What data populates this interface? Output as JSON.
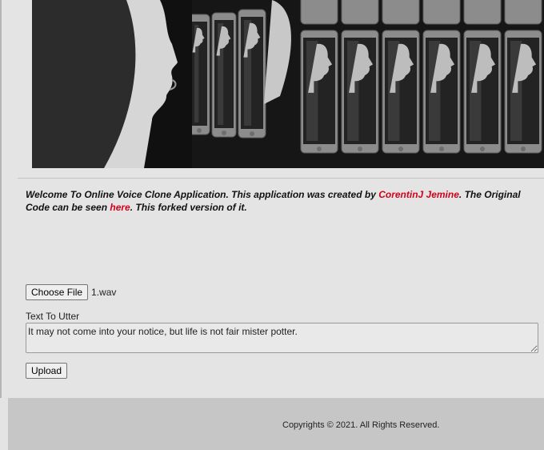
{
  "hero": {
    "image_name": "mirrored-faces-in-phones-banner"
  },
  "intro": {
    "text_before_author": "Welcome To Online Voice Clone Application. This application was created by ",
    "author_link": "CorentinJ Jemine",
    "text_before_link": ". The Original Code can be seen ",
    "code_link": "here",
    "text_after_link": ". This forked version of it.",
    "link_color": "#d0021b"
  },
  "file_input": {
    "button_label": "Choose File",
    "selected_file": "1.wav"
  },
  "utterance": {
    "label": "Text To Utter",
    "value": "It may not come into your notice, but life is not fair mister potter."
  },
  "upload": {
    "button_label": "Upload"
  },
  "footer": {
    "copyright": "Copyrights © 2021. All Rights Reserved."
  }
}
